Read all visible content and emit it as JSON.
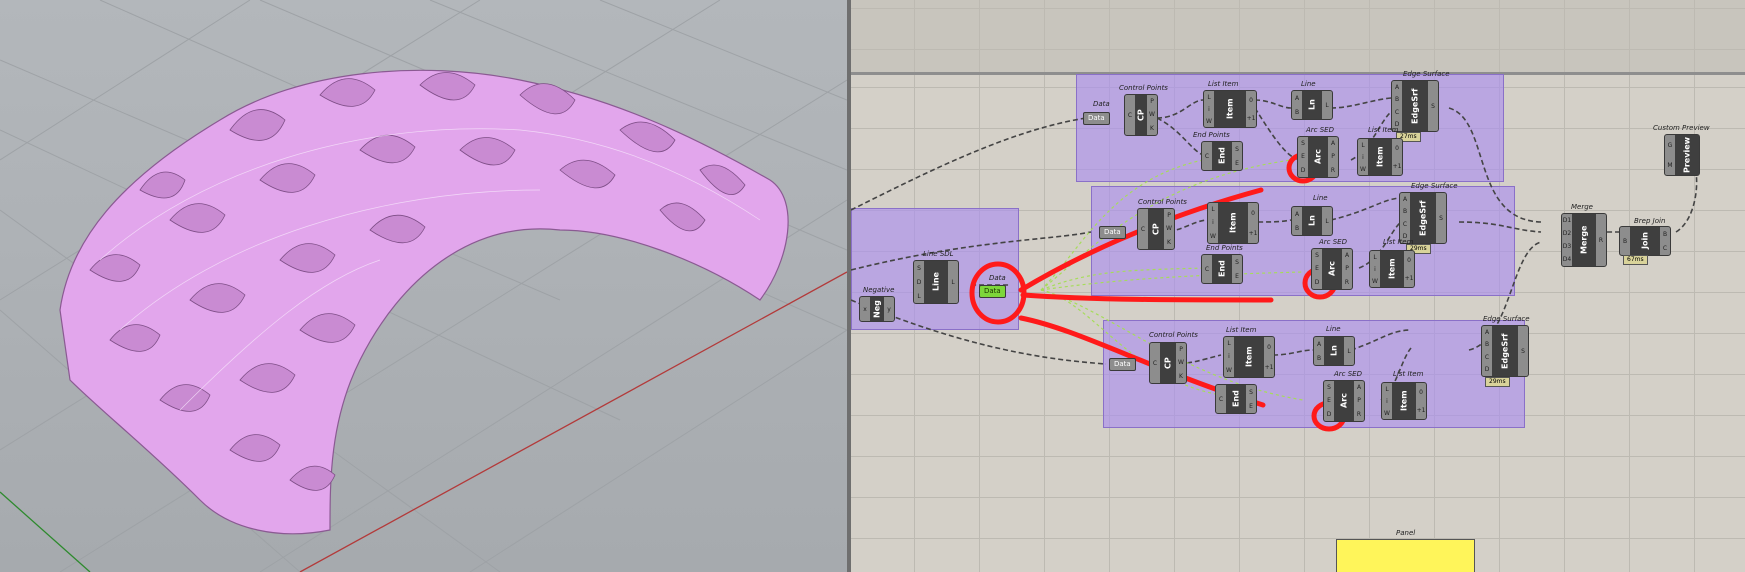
{
  "colors": {
    "surface": "#e6a9ef",
    "group": "#aa8cf0",
    "annotation": "#ff1a1a",
    "data_param": "#7dd63b",
    "panel": "#fff55a"
  },
  "canvas": {
    "labels": {
      "data_top": "Data",
      "control_points_1": "Control Points",
      "list_item_1": "List Item",
      "line_1": "Line",
      "edge_surface_1": "Edge Surface",
      "end_points_1": "End Points",
      "arc_sed_1": "Arc SED",
      "list_item_1b": "List Item",
      "custom_preview": "Custom Preview",
      "control_points_2": "Control Points",
      "line_2": "Line",
      "edge_surface_2": "Edge Surface",
      "end_points_2": "End Points",
      "arc_sed_2": "Arc SED",
      "list_item_2": "List Item",
      "merge": "Merge",
      "brep_join": "Brep Join",
      "line_sdl": "Line SDL",
      "negative": "Negative",
      "data_center": "Data",
      "control_points_3": "Control Points",
      "list_item_3": "List Item",
      "line_3": "Line",
      "edge_surface_3": "Edge Surface",
      "arc_sed_3": "Arc SED",
      "list_item_3b": "List Item",
      "panel": "Panel"
    },
    "nodes": {
      "data": "Data",
      "cp": "CP",
      "item": "Item",
      "ln": "Ln",
      "edgesrf": "EdgeSrf",
      "end": "End",
      "arc": "Arc",
      "preview": "Preview",
      "merge": "Merge",
      "join": "Join",
      "line": "Line",
      "neg": "Neg"
    },
    "timings": {
      "edgesrf_1": "27ms",
      "edgesrf_2": "29ms",
      "brep_join": "67ms",
      "edgesrf_3": "29ms"
    }
  }
}
